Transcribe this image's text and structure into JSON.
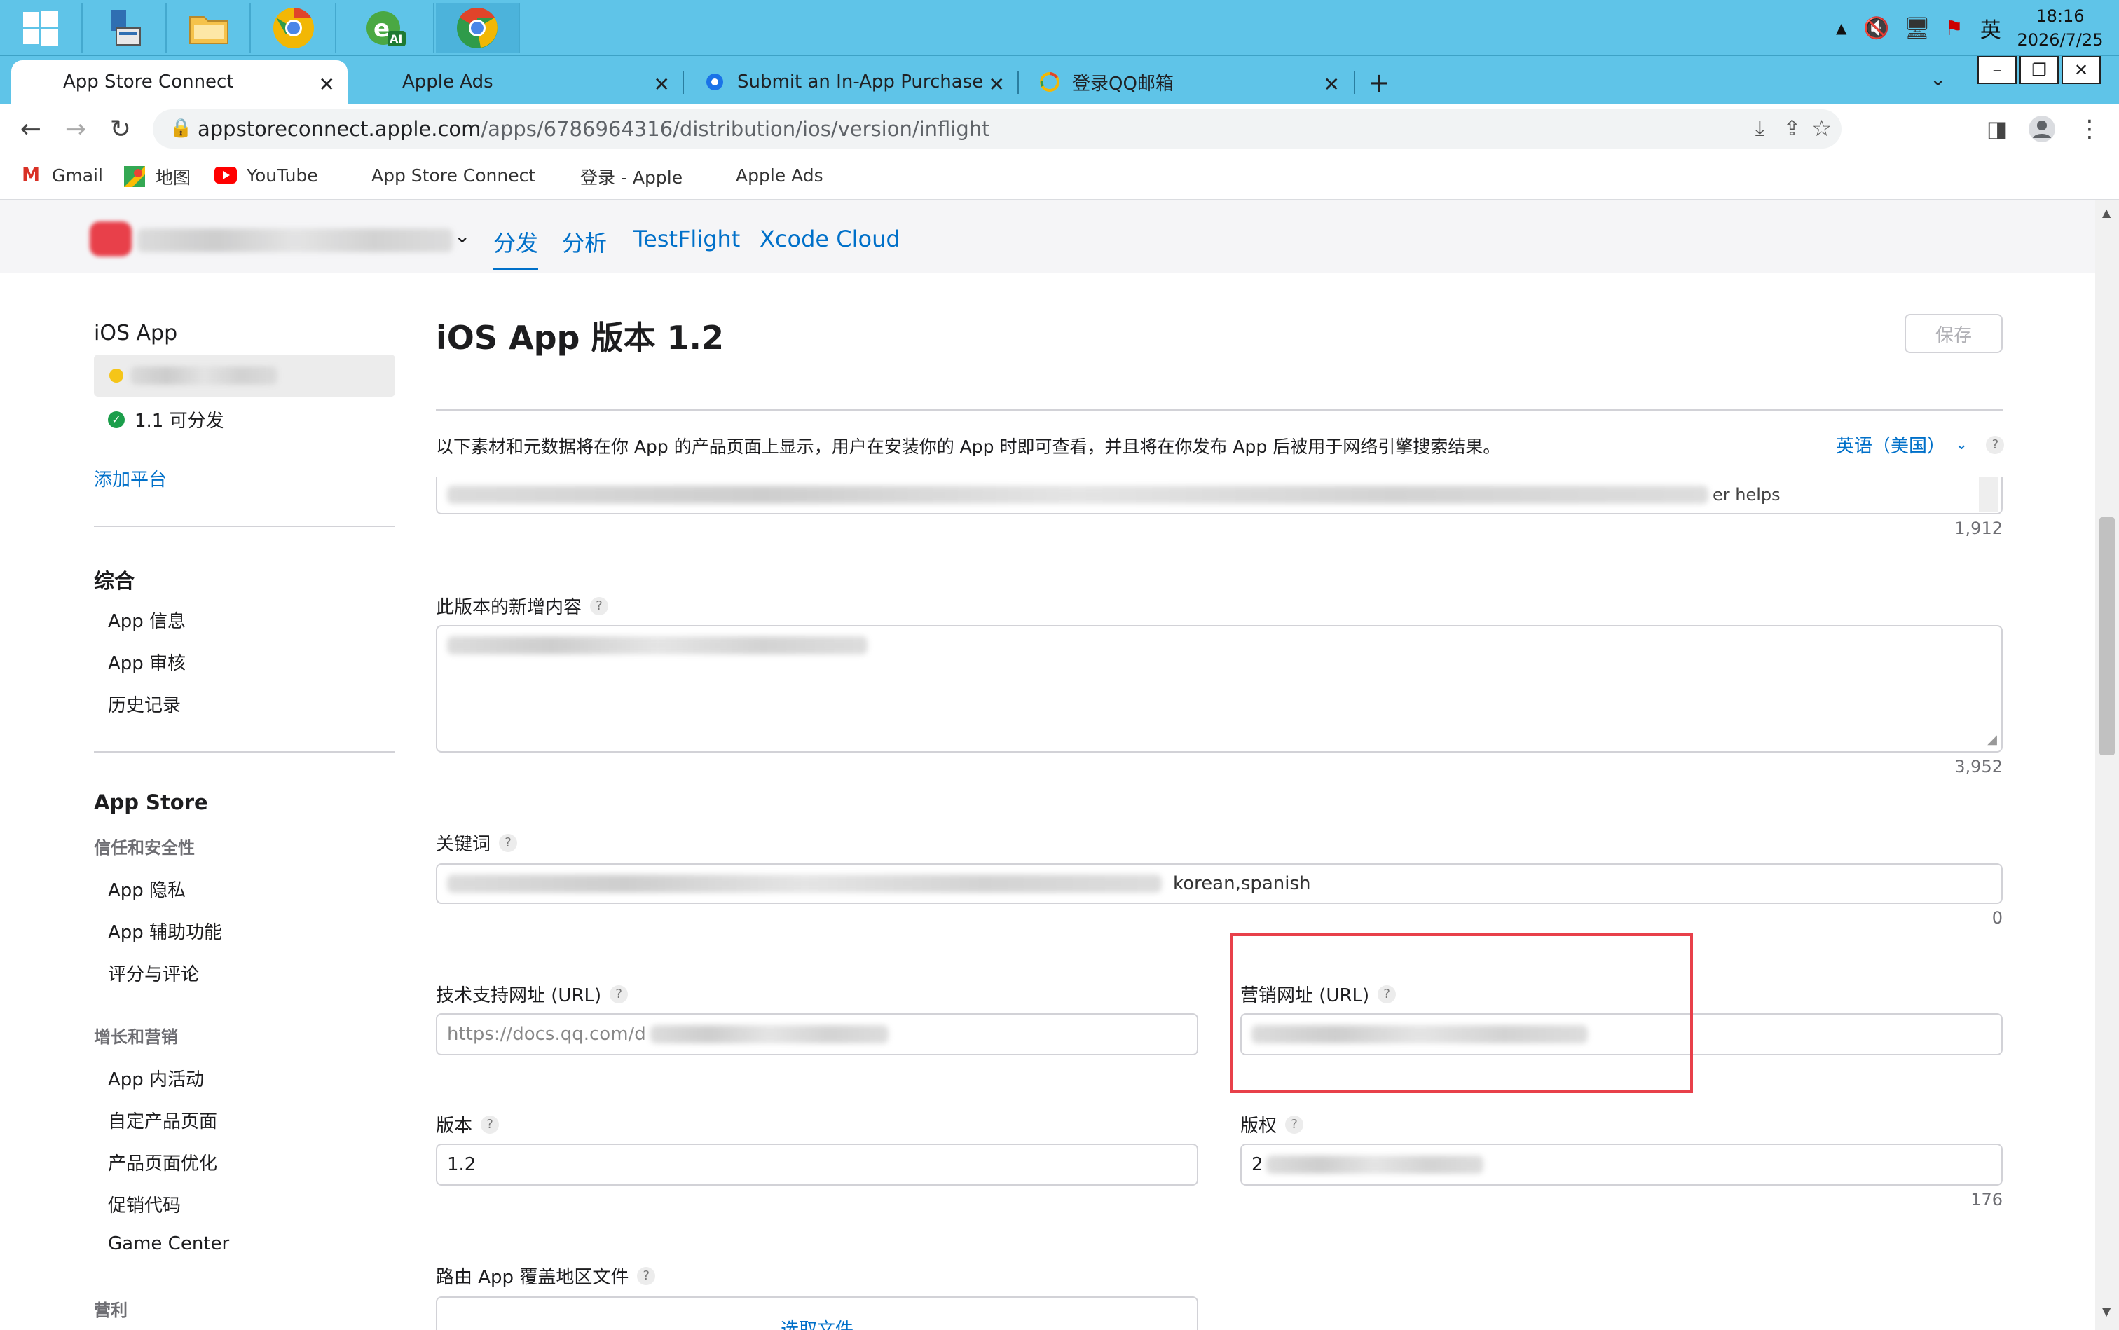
{
  "taskbar": {
    "apps": [
      "windows-start",
      "file-manager",
      "folder",
      "chrome-canary",
      "ie-ai",
      "chrome"
    ],
    "tray": {
      "ime": "英",
      "time": "18:16",
      "date": "2026/7/25"
    }
  },
  "tabs": [
    {
      "title": "App Store Connect",
      "active": true
    },
    {
      "title": "Apple Ads",
      "active": false
    },
    {
      "title": "Submit an In-App Purchase - ",
      "active": false
    },
    {
      "title": "登录QQ邮箱",
      "active": false
    }
  ],
  "window_controls": {
    "minimize": "–",
    "restore": "❐",
    "close": "✕"
  },
  "address": {
    "host": "appstoreconnect.apple.com",
    "path": "/apps/6786964316/distribution/ios/version/inflight"
  },
  "bookmarks": [
    "Gmail",
    "地图",
    "YouTube",
    "App Store Connect",
    "登录 - Apple",
    "Apple Ads"
  ],
  "app_nav": {
    "tabs": [
      "分发",
      "分析",
      "TestFlight",
      "Xcode Cloud"
    ],
    "active": "分发"
  },
  "sidebar": {
    "platform_title": "iOS App",
    "version_ready": "1.1 可分发",
    "add_platform": "添加平台",
    "general_title": "综合",
    "general_items": [
      "App 信息",
      "App 审核",
      "历史记录"
    ],
    "appstore_title": "App Store",
    "trust_title": "信任和安全性",
    "trust_items": [
      "App 隐私",
      "App 辅助功能",
      "评分与评论"
    ],
    "growth_title": "增长和营销",
    "growth_items": [
      "App 内活动",
      "自定产品页面",
      "产品页面优化",
      "促销代码",
      "Game Center"
    ],
    "monetize_title": "营利"
  },
  "main": {
    "title": "iOS App 版本 1.2",
    "save_label": "保存",
    "intro": "以下素材和元数据将在你 App 的产品页面上显示，用户在安装你的 App 时即可查看，并且将在你发布 App 后被用于网络引擎搜索结果。",
    "locale": "英语（美国）",
    "description_tail": "er helps",
    "description_count": "1,912",
    "whats_new_label": "此版本的新增内容",
    "whats_new_count": "3,952",
    "keywords_label": "关键词",
    "keywords_tail": "korean,spanish",
    "keywords_count": "0",
    "support_url_label": "技术支持网址 (URL)",
    "support_url_value": "https://docs.qq.com/d",
    "marketing_url_label": "营销网址 (URL)",
    "version_label": "版本",
    "version_value": "1.2",
    "copyright_label": "版权",
    "copyright_value": "2",
    "copyright_count": "176",
    "routing_label": "路由 App 覆盖地区文件",
    "choose_file": "选取文件"
  },
  "colors": {
    "accent": "#0070c9",
    "taskbar": "#5fc4e8",
    "highlight_box": "#e8404a",
    "ready_green": "#1b9e4b"
  }
}
